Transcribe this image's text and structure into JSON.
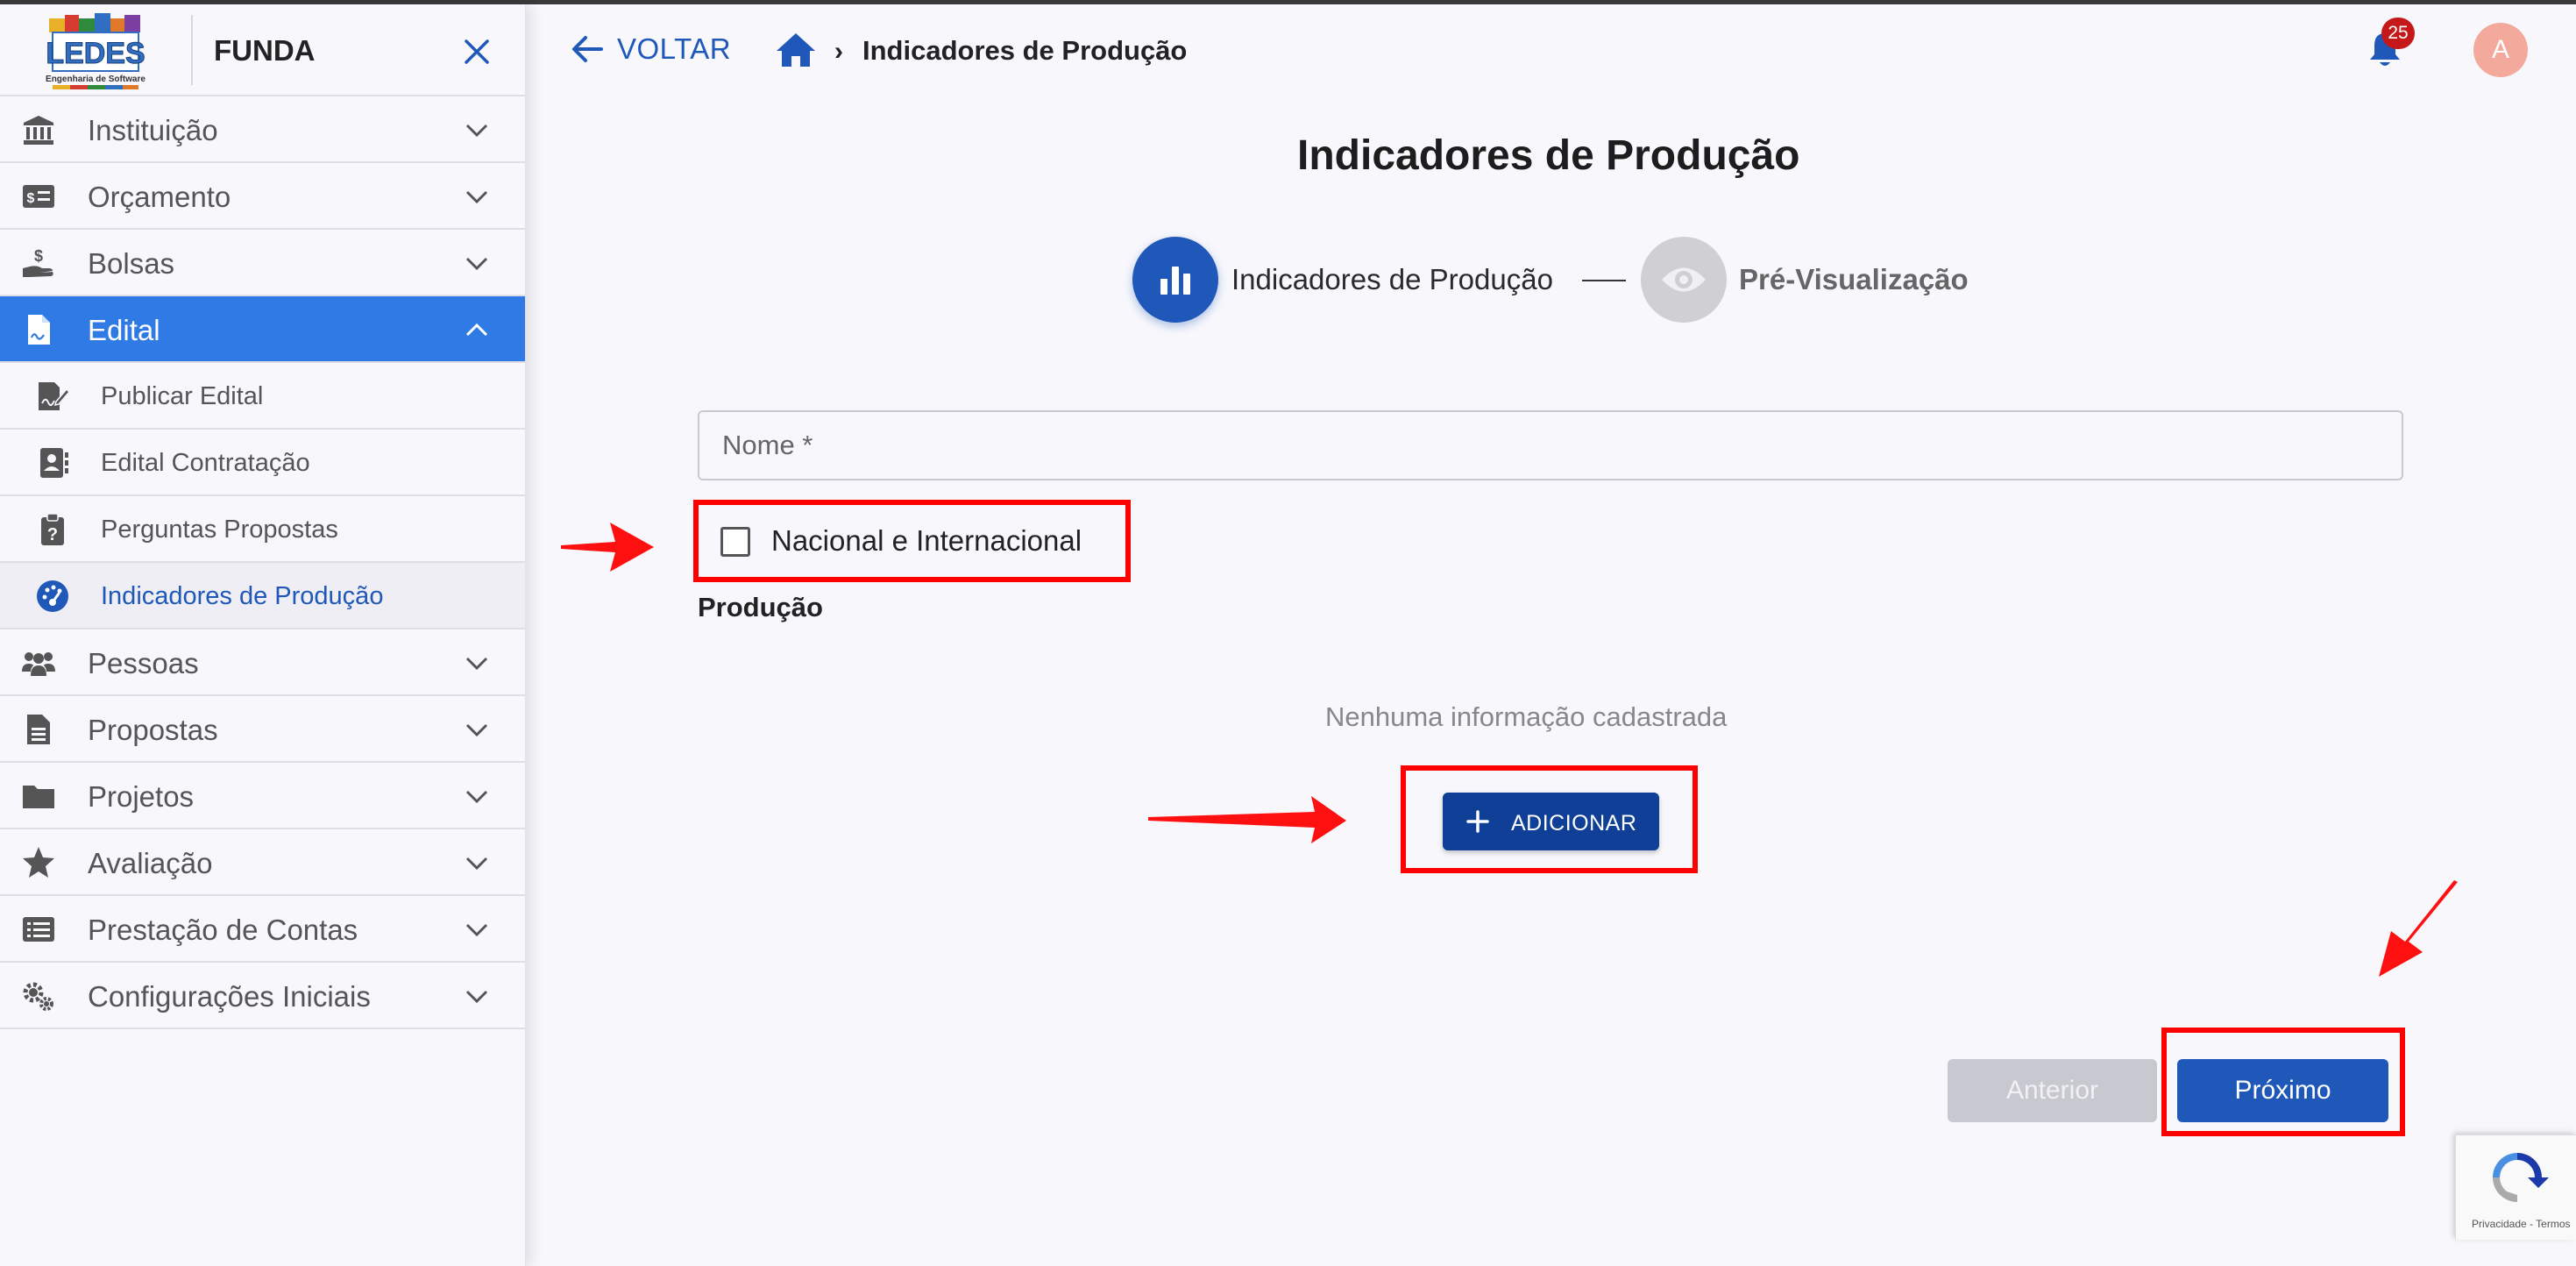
{
  "sidebar": {
    "brand": "FUNDA",
    "logo_text": "LEDES",
    "logo_subtext": "Engenharia de Software",
    "menu": [
      {
        "label": "Instituição"
      },
      {
        "label": "Orçamento"
      },
      {
        "label": "Bolsas"
      },
      {
        "label": "Edital"
      },
      {
        "label": "Pessoas"
      },
      {
        "label": "Propostas"
      },
      {
        "label": "Projetos"
      },
      {
        "label": "Avaliação"
      },
      {
        "label": "Prestação de Contas"
      },
      {
        "label": "Configurações Iniciais"
      }
    ],
    "submenu": [
      {
        "label": "Publicar Edital"
      },
      {
        "label": "Edital Contratação"
      },
      {
        "label": "Perguntas Propostas"
      },
      {
        "label": "Indicadores de Produção"
      }
    ]
  },
  "header": {
    "back_label": "VOLTAR",
    "breadcrumb": "Indicadores de Produção",
    "notification_count": "25",
    "avatar_initial": "A"
  },
  "main": {
    "title": "Indicadores de Produção",
    "steps": [
      {
        "label": "Indicadores de Produção"
      },
      {
        "label": "Pré-Visualização"
      }
    ],
    "name_field": {
      "placeholder": "Nome *",
      "value": ""
    },
    "checkbox_label": "Nacional e Internacional",
    "section_label": "Produção",
    "empty_message": "Nenhuma informação cadastrada",
    "add_label": "ADICIONAR",
    "prev_label": "Anterior",
    "next_label": "Próximo"
  },
  "recaptcha": {
    "footer": "Privacidade - Termos"
  },
  "colors": {
    "primary": "#1f58b8",
    "active_menu": "#2f7ae5",
    "add_button": "#0f3f96",
    "annotation": "#ff0000",
    "badge": "#c5181b",
    "avatar": "#f3a99c"
  }
}
